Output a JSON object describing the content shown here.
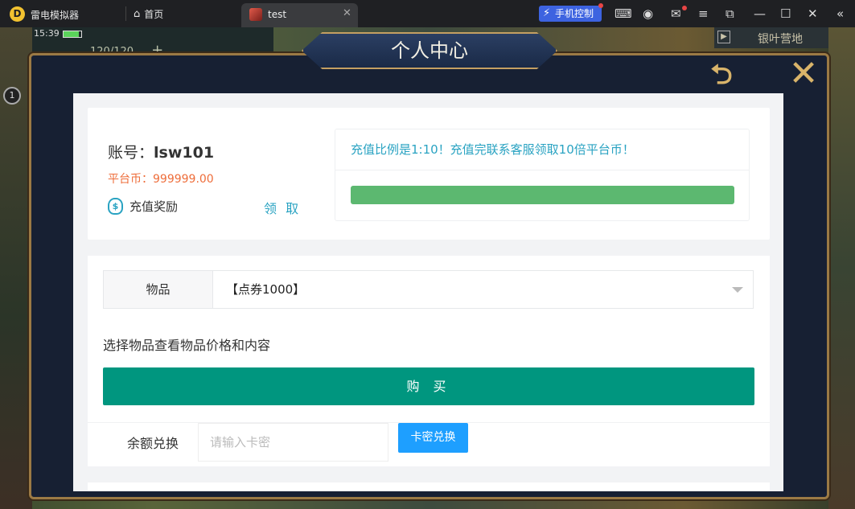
{
  "titlebar": {
    "app_name": "雷电模拟器",
    "home_label": "首页",
    "tab_label": "test",
    "tab_close": "✕",
    "phone_control": "手机控制"
  },
  "game_hud": {
    "time": "15:39",
    "energy": "120/120",
    "energy_plus": "+",
    "level": "1",
    "right_label": "银叶营地"
  },
  "modal": {
    "title": "个人中心",
    "back_glyph": "⮌",
    "close_glyph": "✕"
  },
  "account": {
    "label": "账号：",
    "username": "lsw101",
    "coins_label": "平台币：",
    "coins_value": "999999.00",
    "reward_label": "充值奖励",
    "claim_label": "领 取"
  },
  "notice": {
    "text": "充值比例是1:10！充值完联系客服领取10倍平台币！",
    "progress": 1.0
  },
  "shop": {
    "item_label": "物品",
    "item_selected": "【点券1000】",
    "hint": "选择物品查看物品价格和内容",
    "buy_label": "购 买",
    "balance_label": "余额兑换",
    "card_placeholder": "请输入卡密",
    "redeem_label": "卡密兑换"
  },
  "colors": {
    "accent_teal": "#00967f",
    "link_blue": "#2aa3c2",
    "coin_orange": "#ee6d3a",
    "progress_green": "#5cb870",
    "redeem_blue": "#1e9fff"
  }
}
